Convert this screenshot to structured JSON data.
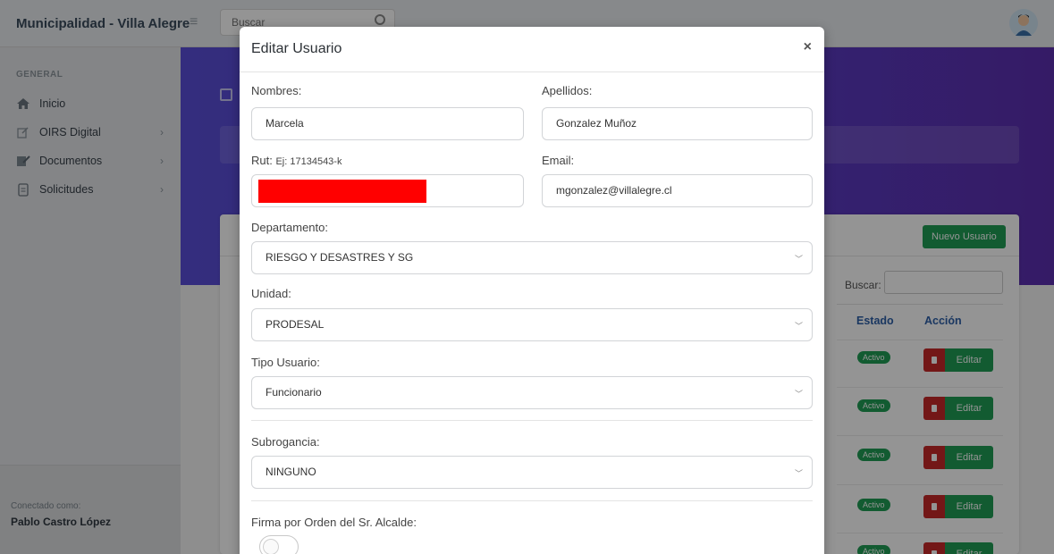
{
  "app": {
    "brand": "Municipalidad - Villa Alegre",
    "search_placeholder": "Buscar"
  },
  "sidebar": {
    "group_label": "GENERAL",
    "items": [
      {
        "label": "Inicio",
        "icon": "home-icon"
      },
      {
        "label": "OIRS Digital",
        "icon": "edit-icon"
      },
      {
        "label": "Documentos",
        "icon": "documents-icon"
      },
      {
        "label": "Solicitudes",
        "icon": "file-icon"
      }
    ],
    "footer_label": "Conectado como:",
    "footer_user": "Pablo Castro López"
  },
  "background_card": {
    "new_user_button": "Nuevo Usuario",
    "search_label": "Buscar:",
    "columns": [
      "Estado",
      "Acción"
    ],
    "rows": [
      {
        "estado": "Activo",
        "accion": "Editar"
      },
      {
        "estado": "Activo",
        "accion": "Editar"
      },
      {
        "estado": "Activo",
        "accion": "Editar"
      },
      {
        "estado": "Activo",
        "accion": "Editar"
      },
      {
        "estado": "Activo",
        "accion": "Editar"
      }
    ]
  },
  "modal": {
    "title": "Editar Usuario",
    "close_symbol": "×",
    "nombres_label": "Nombres:",
    "nombres_value": "Marcela",
    "apellidos_label": "Apellidos:",
    "apellidos_value": "Gonzalez Muñoz",
    "rut_label": "Rut:",
    "rut_hint": "Ej: 17134543-k",
    "email_label": "Email:",
    "email_value": "mgonzalez@villalegre.cl",
    "departamento_label": "Departamento:",
    "departamento_value": "RIESGO Y DESASTRES Y SG",
    "unidad_label": "Unidad:",
    "unidad_value": "PRODESAL",
    "tipo_label": "Tipo Usuario:",
    "tipo_value": "Funcionario",
    "subrogancia_label": "Subrogancia:",
    "subrogancia_value": "NINGUNO",
    "firma_label": "Firma por Orden del Sr. Alcalde:"
  },
  "colors": {
    "accent_green": "#1f9d55",
    "danger_red": "#c62828",
    "banner_purple": "#5a4fd9",
    "redaction": "#ff0000"
  }
}
